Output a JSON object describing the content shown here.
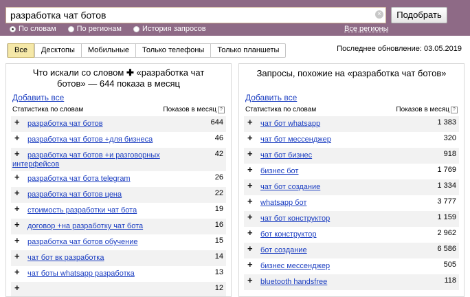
{
  "search": {
    "query": "разработка чат ботов",
    "submit_label": "Подобрать",
    "clear_symbol": "×",
    "modes": [
      {
        "label": "По словам",
        "checked": true
      },
      {
        "label": "По регионам",
        "checked": false
      },
      {
        "label": "История запросов",
        "checked": false
      }
    ],
    "regions_label": "Все регионы"
  },
  "tabs": [
    "Все",
    "Десктопы",
    "Мобильные",
    "Только телефоны",
    "Только планшеты"
  ],
  "active_tab": "Все",
  "updated_text": "Последнее обновление: 03.05.2019",
  "left": {
    "title_prefix": "Что искали со словом",
    "title_plus": "✚",
    "title_line1_rest": "«разработка чат",
    "title_line2": "ботов» — 644 показа в месяц",
    "add_all": "Добавить все",
    "col_words": "Статистика по словам",
    "col_shows": "Показов в месяц",
    "help": "?",
    "rows": [
      {
        "phrase": "разработка чат ботов",
        "count": "644"
      },
      {
        "phrase": "разработка чат ботов +для бизнеса",
        "count": "46"
      },
      {
        "phrase": "разработка чат ботов +и разговорных интерфейсов",
        "count": "42"
      },
      {
        "phrase": "разработка чат бота telegram",
        "count": "26"
      },
      {
        "phrase": "разработка чат ботов цена",
        "count": "22"
      },
      {
        "phrase": "стоимость разработки чат бота",
        "count": "19"
      },
      {
        "phrase": "договор +на разработку чат бота",
        "count": "16"
      },
      {
        "phrase": "разработка чат ботов обучение",
        "count": "15"
      },
      {
        "phrase": "чат бот вк разработка",
        "count": "14"
      },
      {
        "phrase": "чат боты whatsapp разработка",
        "count": "13"
      },
      {
        "phrase": "",
        "count": "12"
      }
    ]
  },
  "right": {
    "title": "Запросы, похожие на «разработка чат ботов»",
    "add_all": "Добавить все",
    "col_words": "Статистика по словам",
    "col_shows": "Показов в месяц",
    "help": "?",
    "rows": [
      {
        "phrase": "чат бот whatsapp",
        "count": "1 383"
      },
      {
        "phrase": "чат бот мессенджер",
        "count": "320"
      },
      {
        "phrase": "чат бот бизнес",
        "count": "918"
      },
      {
        "phrase": "бизнес бот",
        "count": "1 769"
      },
      {
        "phrase": "чат бот создание",
        "count": "1 334"
      },
      {
        "phrase": "whatsapp бот",
        "count": "3 777"
      },
      {
        "phrase": "чат бот конструктор",
        "count": "1 159"
      },
      {
        "phrase": "бот конструктор",
        "count": "2 962"
      },
      {
        "phrase": "бот создание",
        "count": "6 586"
      },
      {
        "phrase": "бизнес мессенджер",
        "count": "505"
      },
      {
        "phrase": "bluetooth handsfree",
        "count": "118"
      }
    ]
  }
}
